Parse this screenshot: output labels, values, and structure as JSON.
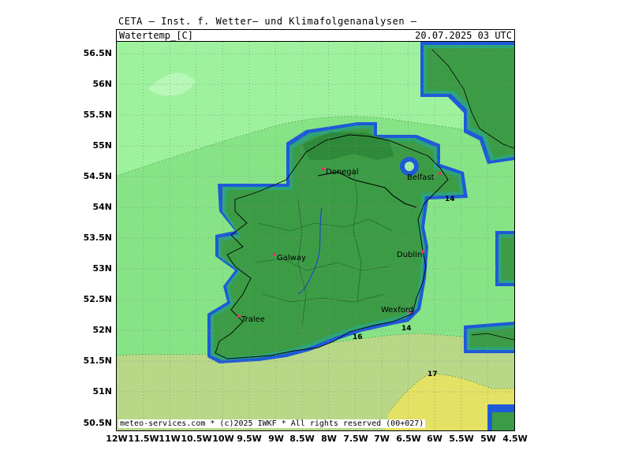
{
  "header": {
    "title": "CETA — Inst. f. Wetter— und Klimafolgenanalysen —",
    "field": "Watertemp_[C]",
    "datetime": "20.07.2025 03 UTC"
  },
  "footer": {
    "credits": "meteo-services.com * (c)2025 IWKF * All rights reserved (00+027)"
  },
  "axes": {
    "lat_labels": [
      "56.5N",
      "56N",
      "55.5N",
      "55N",
      "54.5N",
      "54N",
      "53.5N",
      "53N",
      "52.5N",
      "52N",
      "51.5N",
      "51N",
      "50.5N"
    ],
    "lon_labels": [
      "12W",
      "11.5W",
      "11W",
      "10.5W",
      "10W",
      "9.5W",
      "9W",
      "8.5W",
      "8W",
      "7.5W",
      "7W",
      "6.5W",
      "6W",
      "5.5W",
      "5W",
      "4.5W"
    ]
  },
  "contours": [
    "14",
    "14",
    "16",
    "17"
  ],
  "cities": [
    "Donegal",
    "Belfast",
    "Galway",
    "Dublin",
    "Tralee",
    "Wexford"
  ],
  "colors": {
    "sea_cool": "#9ef29e",
    "sea_mid": "#86e486",
    "sea_warm": "#b8d888",
    "sea_hot": "#e4e264",
    "land": "#3c9c46",
    "coast_blue": "#1e5ad8",
    "city_marker": "#e8336a"
  }
}
